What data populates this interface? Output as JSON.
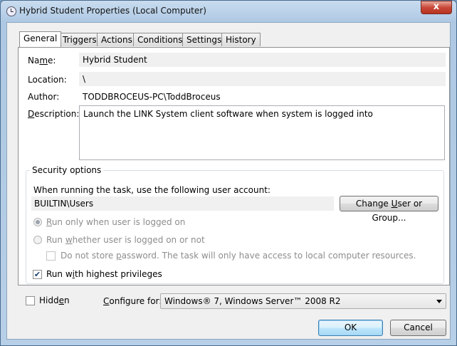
{
  "window": {
    "title": "Hybrid Student Properties (Local Computer)",
    "close_glyph": "x"
  },
  "tabs": [
    {
      "label": "General"
    },
    {
      "label": "Triggers"
    },
    {
      "label": "Actions"
    },
    {
      "label": "Conditions"
    },
    {
      "label": "Settings"
    },
    {
      "label": "History"
    }
  ],
  "general": {
    "name_label_pre": "Na",
    "name_label_u": "m",
    "name_label_post": "e:",
    "name_value": "Hybrid Student",
    "location_label": "Location:",
    "location_value": "\\",
    "author_label": "Author:",
    "author_value": "TODDBROCEUS-PC\\ToddBroceus",
    "description_label_u": "D",
    "description_label_post": "escription:",
    "description_value": "Launch the LINK System client software when system is logged into"
  },
  "security": {
    "legend": "Security options",
    "account_prompt": "When running the task, use the following user account:",
    "account_value": "BUILTIN\\Users",
    "change_button_pre": "Change ",
    "change_button_u": "U",
    "change_button_post": "ser or Group...",
    "radio1_u": "R",
    "radio1_post": "un only when user is logged on",
    "radio2_pre": "Run ",
    "radio2_u": "w",
    "radio2_post": "hether user is logged on or not",
    "store_pw_pre": "Do not store ",
    "store_pw_u": "p",
    "store_pw_post": "assword.  The task will only have access to local computer resources.",
    "highest_pre": "Run w",
    "highest_u": "i",
    "highest_post": "th highest privileges",
    "highest_checked": "✔"
  },
  "footer": {
    "hidden_pre": "Hidd",
    "hidden_u": "e",
    "hidden_post": "n",
    "configure_u": "C",
    "configure_post": "onfigure for:",
    "configure_value": "Windows® 7, Windows Server™ 2008 R2",
    "ok_label": "OK",
    "cancel_label": "Cancel"
  }
}
